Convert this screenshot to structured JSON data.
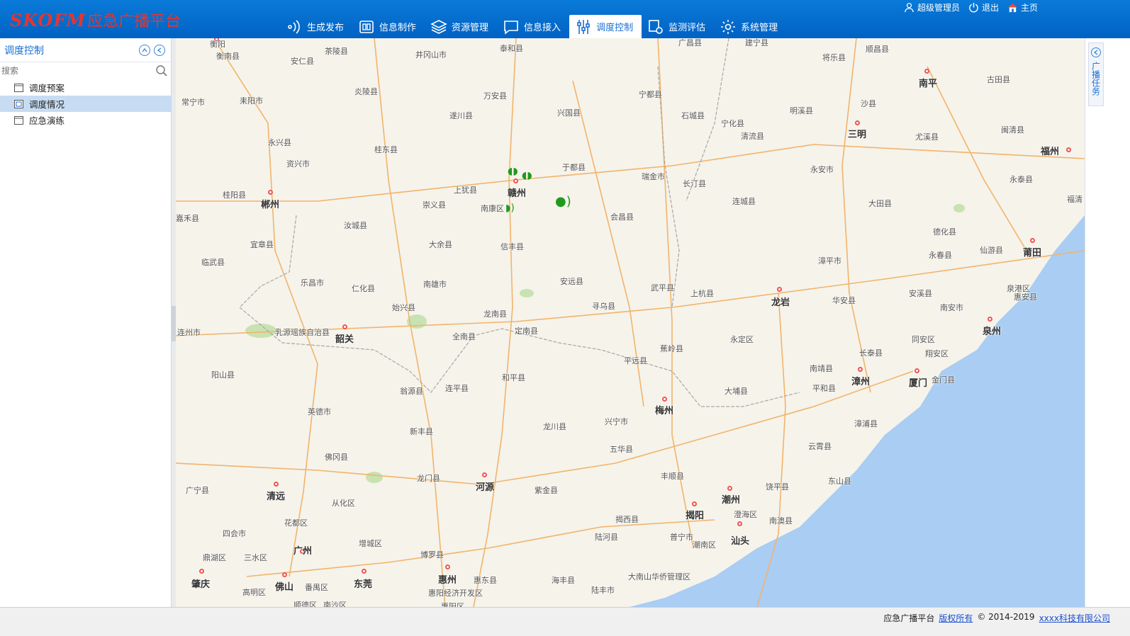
{
  "app": {
    "brand": "SKOFM",
    "title": "应急广播平台"
  },
  "user_bar": {
    "user": "超级管理员",
    "logout": "退出",
    "home": "主页"
  },
  "nav": [
    {
      "label": "生成发布",
      "icon": "broadcast-signal-icon"
    },
    {
      "label": "信息制作",
      "icon": "info-card-icon"
    },
    {
      "label": "资源管理",
      "icon": "layers-icon"
    },
    {
      "label": "信息接入",
      "icon": "chat-bubble-icon"
    },
    {
      "label": "调度控制",
      "icon": "sliders-icon",
      "active": true
    },
    {
      "label": "监测评估",
      "icon": "monitor-gear-icon"
    },
    {
      "label": "系统管理",
      "icon": "gear-icon"
    }
  ],
  "sidebar": {
    "title": "调度控制",
    "search_placeholder": "搜索",
    "items": [
      {
        "label": "调度预案",
        "selected": false
      },
      {
        "label": "调度情况",
        "selected": true
      },
      {
        "label": "应急演练",
        "selected": false
      }
    ]
  },
  "right_panel": {
    "tab_label": "广播任务"
  },
  "map": {
    "cities": [
      "衡阳",
      "衡南县",
      "茶陵县",
      "井冈山市",
      "泰和县",
      "广昌县",
      "建宁县",
      "顺昌县",
      "南平",
      "古田县",
      "将乐县",
      "安仁县",
      "常宁市",
      "耒阳市",
      "炎陵县",
      "万安县",
      "遂川县",
      "兴国县",
      "宁都县",
      "石城县",
      "宁化县",
      "明溪县",
      "沙县",
      "三明",
      "尤溪县",
      "闽清县",
      "福州",
      "永兴县",
      "资兴市",
      "桂东县",
      "于都县",
      "瑞金市",
      "长汀县",
      "清流县",
      "永安市",
      "永泰县",
      "桂阳县",
      "郴州",
      "上犹县",
      "赣州",
      "崇义县",
      "南康区",
      "会昌县",
      "连城县",
      "大田县",
      "福清",
      "嘉禾县",
      "汝城县",
      "宜章县",
      "大余县",
      "信丰县",
      "德化县",
      "仙游县",
      "莆田",
      "临武县",
      "永春县",
      "乐昌市",
      "仁化县",
      "南雄市",
      "安远县",
      "武平县",
      "上杭县",
      "漳平市",
      "龙岩",
      "华安县",
      "安溪县",
      "泉港区",
      "惠安县",
      "始兴县",
      "龙南县",
      "寻乌县",
      "南安市",
      "泉州",
      "连州市",
      "乳源瑶族自治县",
      "韶关",
      "全南县",
      "定南县",
      "蕉岭县",
      "永定区",
      "同安区",
      "长泰县",
      "翔安区",
      "阳山县",
      "平远县",
      "南靖县",
      "漳州",
      "厦门",
      "金门县",
      "翁源县",
      "连平县",
      "和平县",
      "梅州",
      "平和县",
      "大埔县",
      "英德市",
      "新丰县",
      "龙川县",
      "兴宁市",
      "漳浦县",
      "五华县",
      "佛冈县",
      "云霄县",
      "东山县",
      "龙门县",
      "河源",
      "紫金县",
      "丰顺县",
      "广宁县",
      "清远",
      "饶平县",
      "潮州",
      "从化区",
      "揭西县",
      "揭阳",
      "澄海区",
      "南澳县",
      "花都区",
      "四会市",
      "陆河县",
      "普宁市",
      "汕头",
      "增城区",
      "广州",
      "潮南区",
      "鼎湖区",
      "三水区",
      "博罗县",
      "肇庆",
      "佛山",
      "东莞",
      "惠州",
      "惠东县",
      "海丰县",
      "陆丰市",
      "大南山华侨管理区",
      "高明区",
      "番禺区",
      "惠阳经济开发区",
      "顺德区",
      "南沙区",
      "惠阳区"
    ]
  },
  "footer": {
    "product": "应急广播平台",
    "rights_link": "版权所有",
    "copyright": "© 2014-2019",
    "company_link": "xxxx科技有限公司"
  }
}
